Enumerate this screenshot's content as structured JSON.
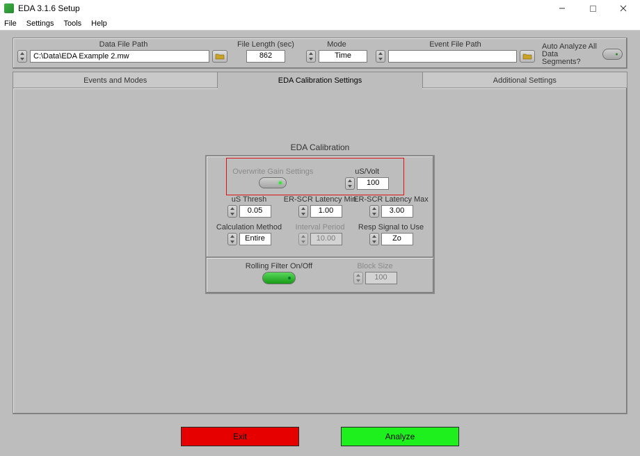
{
  "window": {
    "title": "EDA 3.1.6 Setup"
  },
  "menu": {
    "file": "File",
    "settings": "Settings",
    "tools": "Tools",
    "help": "Help"
  },
  "top": {
    "dataFilePath_label": "Data File Path",
    "dataFilePath_value": "C:\\Data\\EDA Example 2.mw",
    "fileLength_label": "File Length (sec)",
    "fileLength_value": "862",
    "mode_label": "Mode",
    "mode_value": "Time",
    "eventFilePath_label": "Event File Path",
    "eventFilePath_value": "",
    "autoAnalyze_line1": "Auto Analyze All",
    "autoAnalyze_line2": "Data Segments?"
  },
  "tabs": {
    "events": "Events and Modes",
    "calib": "EDA Calibration Settings",
    "additional": "Additional Settings"
  },
  "section": {
    "title": "EDA Calibration"
  },
  "cal": {
    "overwrite_label": "Overwrite Gain Settings",
    "usvolt_label": "uS/Volt",
    "usvolt_value": "100",
    "usthresh_label": "uS Thresh",
    "usthresh_value": "0.05",
    "latmin_label": "ER-SCR Latency Min",
    "latmin_value": "1.00",
    "latmax_label": "ER-SCR Latency Max",
    "latmax_value": "3.00",
    "calcmethod_label": "Calculation Method",
    "calcmethod_value": "Entire",
    "interval_label": "Interval Period",
    "interval_value": "10.00",
    "respsignal_label": "Resp Signal to Use",
    "respsignal_value": "Zo",
    "rolling_label": "Rolling Filter On/Off",
    "blocksize_label": "Block Size",
    "blocksize_value": "100"
  },
  "buttons": {
    "exit": "Exit",
    "analyze": "Analyze"
  }
}
